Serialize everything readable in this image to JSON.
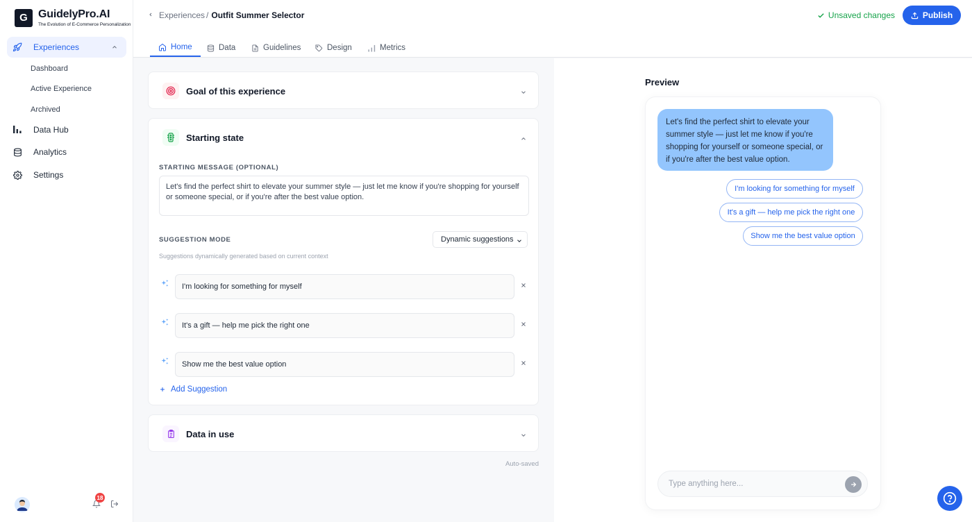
{
  "brand": {
    "logo_letter": "G",
    "name": "GuidelyPro.AI",
    "tagline": "The Evolution of E-Commerce Personalization"
  },
  "sidebar": {
    "items": [
      {
        "label": "Experiences",
        "icon": "rocket-icon",
        "active": true,
        "expanded": true,
        "children": [
          "Dashboard",
          "Active Experience",
          "Archived"
        ]
      },
      {
        "label": "Data Hub",
        "icon": "bar-chart-icon"
      },
      {
        "label": "Analytics",
        "icon": "database-icon"
      },
      {
        "label": "Settings",
        "icon": "gear-icon"
      }
    ],
    "notification_count": "18"
  },
  "header": {
    "breadcrumb_parent": "Experiences",
    "breadcrumb_sep": "/",
    "title": "Outfit Summer Selector",
    "status": "Unsaved changes",
    "publish_label": "Publish"
  },
  "tabs": [
    {
      "label": "Home",
      "icon": "home-icon",
      "active": true
    },
    {
      "label": "Data",
      "icon": "database-icon"
    },
    {
      "label": "Guidelines",
      "icon": "document-icon"
    },
    {
      "label": "Design",
      "icon": "tag-icon"
    },
    {
      "label": "Metrics",
      "icon": "bar-chart-icon"
    }
  ],
  "sections": {
    "goal": {
      "title": "Goal of this experience",
      "expanded": false
    },
    "starting_state": {
      "title": "Starting state",
      "expanded": true,
      "message_label": "STARTING MESSAGE (OPTIONAL)",
      "message": "Let's find the perfect shirt to elevate your summer style — just let me know if you're shopping for yourself or someone special, or if you're after the best value option.",
      "mode_label": "SUGGESTION MODE",
      "mode_value": "Dynamic suggestions",
      "mode_hint": "Suggestions dynamically generated based on current context",
      "suggestions": [
        "I'm looking for something for myself",
        "It's a gift — help me pick the right one",
        "Show me the best value option"
      ],
      "add_label": "Add Suggestion"
    },
    "data_in_use": {
      "title": "Data in use",
      "expanded": false
    },
    "autosaved": "Auto-saved"
  },
  "preview": {
    "title": "Preview",
    "bot_message": "Let's find the perfect shirt to elevate your summer style — just let me know if you're shopping for yourself or someone special, or if you're after the best value option.",
    "chips": [
      "I'm looking for something for myself",
      "It's a gift — help me pick the right one",
      "Show me the best value option"
    ],
    "input_placeholder": "Type anything here..."
  },
  "colors": {
    "accent": "#2563eb",
    "success": "#16a34a",
    "bubble": "#93c5fd",
    "badge": "#ef4444"
  }
}
